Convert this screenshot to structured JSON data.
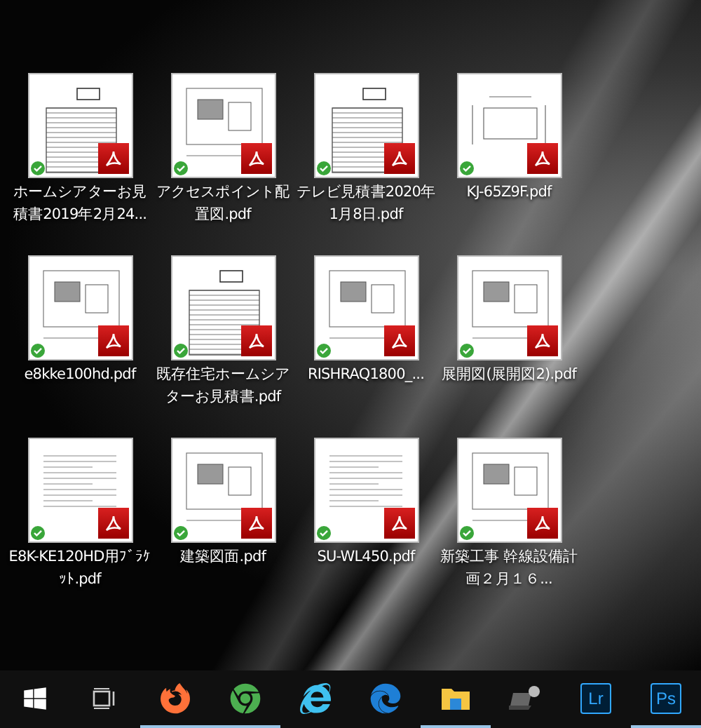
{
  "desktop_icons": [
    {
      "name": "ホームシアターお見積書2019年2月24...",
      "synced": true,
      "kind": "sheet"
    },
    {
      "name": "アクセスポイント配置図.pdf",
      "synced": true,
      "kind": "plan"
    },
    {
      "name": "テレビ見積書2020年1月8日.pdf",
      "synced": true,
      "kind": "sheet"
    },
    {
      "name": "KJ-65Z9F.pdf",
      "synced": true,
      "kind": "screen"
    },
    {
      "name": "e8kke100hd.pdf",
      "synced": true,
      "kind": "plan"
    },
    {
      "name": "既存住宅ホームシアターお見積書.pdf",
      "synced": true,
      "kind": "sheet"
    },
    {
      "name": "RISHRAQ1800_...",
      "synced": true,
      "kind": "plan"
    },
    {
      "name": "展開図(展開図2).pdf",
      "synced": true,
      "kind": "plan"
    },
    {
      "name": "E8K-KE120HD用ﾌﾞﾗｹｯﾄ.pdf",
      "synced": true,
      "kind": "text"
    },
    {
      "name": "建築図面.pdf",
      "synced": true,
      "kind": "plan"
    },
    {
      "name": "SU-WL450.pdf",
      "synced": true,
      "kind": "text"
    },
    {
      "name": "新築工事 幹線設備計画２月１６...",
      "synced": true,
      "kind": "plan"
    }
  ],
  "taskbar": [
    {
      "kind": "start",
      "running": false
    },
    {
      "kind": "taskview",
      "running": false
    },
    {
      "kind": "firefox",
      "running": true
    },
    {
      "kind": "chrome",
      "running": true
    },
    {
      "kind": "ie",
      "running": false
    },
    {
      "kind": "edge",
      "running": false
    },
    {
      "kind": "explorer",
      "running": true
    },
    {
      "kind": "laptop",
      "running": false
    },
    {
      "kind": "app",
      "label": "Lr",
      "running": false
    },
    {
      "kind": "app",
      "label": "Ps",
      "running": true
    }
  ]
}
